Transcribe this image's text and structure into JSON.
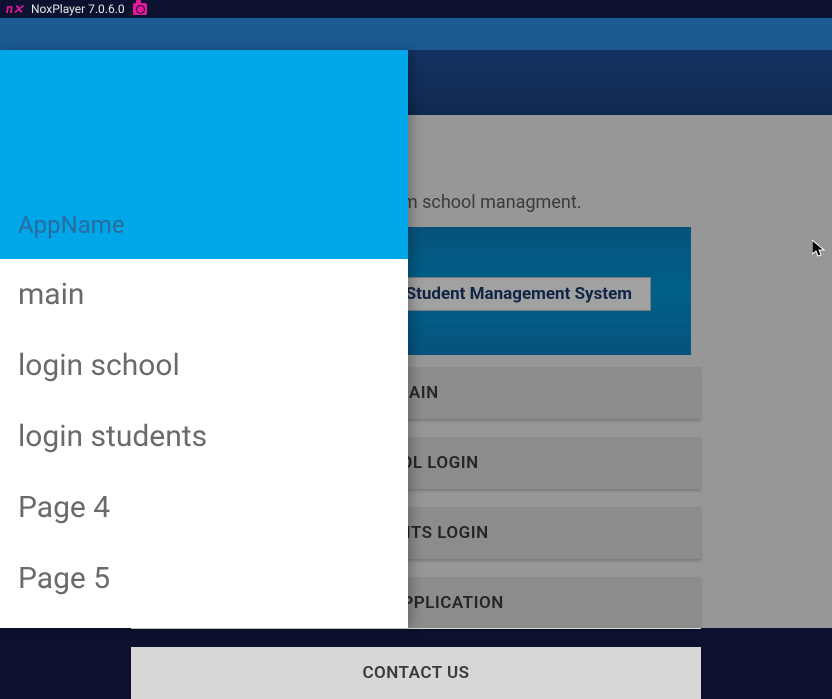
{
  "titlebar": {
    "app": "NoxPlayer 7.0.6.0",
    "logo": "nox"
  },
  "underlay": {
    "welcome": "Welcome to sysstem school managment.",
    "banner_label": "Student Management System",
    "buttons": {
      "main": "MAIN",
      "school_login": "SCHOOL LOGIN",
      "students_login": "STUDENTS LOGIN",
      "about": "ABOUT APPLICATION",
      "contact": "CONTACT US"
    }
  },
  "drawer": {
    "header": "AppName",
    "items": {
      "main": "main",
      "login_school": "login school",
      "login_students": "login students",
      "page4": "Page 4",
      "page5": "Page 5"
    }
  }
}
